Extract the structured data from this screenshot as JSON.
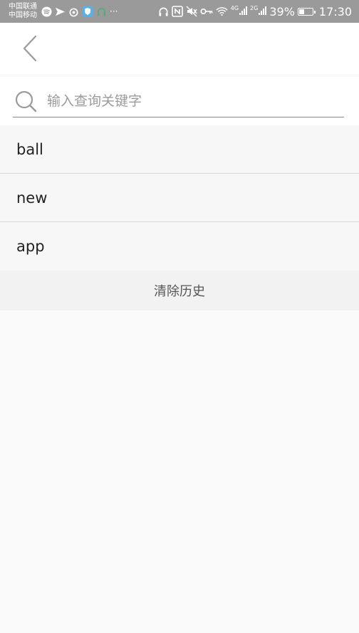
{
  "status_bar": {
    "carrier_1": "中国联通",
    "carrier_2": "中国移动",
    "overflow": "···",
    "net_1": "4G",
    "net_2": "2G",
    "battery": "39%",
    "battery_level": 0.39,
    "time": "17:30"
  },
  "header": {
    "back_icon": "chevron-left-icon"
  },
  "search": {
    "placeholder": "输入查询关键字",
    "value": "",
    "icon": "search-icon"
  },
  "history": {
    "items": [
      {
        "label": "ball"
      },
      {
        "label": "new"
      },
      {
        "label": "app"
      }
    ],
    "clear_label": "清除历史"
  },
  "colors": {
    "status_bar": "#9a9a9a",
    "background": "#fafafa",
    "divider": "#d9d9d9"
  }
}
